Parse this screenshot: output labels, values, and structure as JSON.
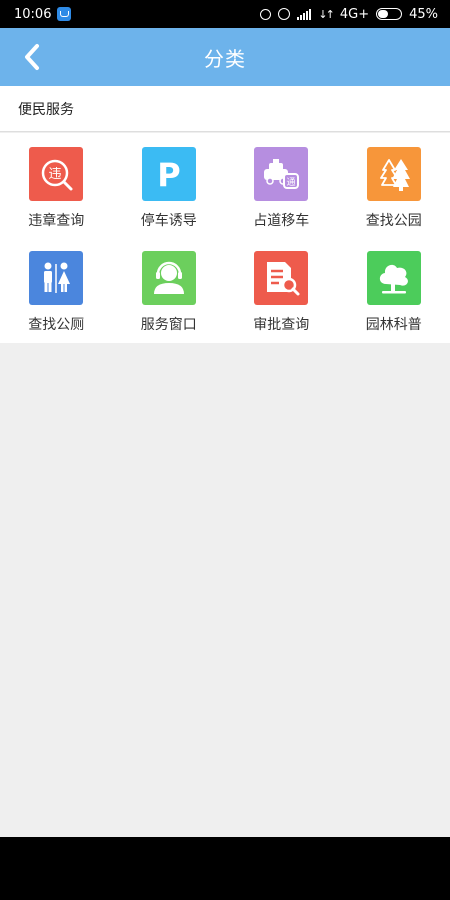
{
  "status_bar": {
    "time": "10:06",
    "network": "4G+",
    "battery": "45%"
  },
  "navbar": {
    "title": "分类"
  },
  "section": {
    "title": "便民服务"
  },
  "grid_items": [
    {
      "label": "违章查询",
      "icon": "violation-query-icon",
      "color": "#ee5b4c"
    },
    {
      "label": "停车诱导",
      "icon": "parking-p-icon",
      "color": "#3bbbf3"
    },
    {
      "label": "占道移车",
      "icon": "move-car-icon",
      "color": "#b68ee0"
    },
    {
      "label": "查找公园",
      "icon": "park-trees-icon",
      "color": "#f7963a"
    },
    {
      "label": "查找公厕",
      "icon": "restroom-icon",
      "color": "#4b86dd"
    },
    {
      "label": "服务窗口",
      "icon": "service-agent-icon",
      "color": "#6ccf5d"
    },
    {
      "label": "审批查询",
      "icon": "document-search-icon",
      "color": "#ee5b4c"
    },
    {
      "label": "园林科普",
      "icon": "tree-icon",
      "color": "#4ccc5b"
    }
  ],
  "tile_glyphs": {
    "violation": "违",
    "parking": "P",
    "car_badge": "通"
  }
}
